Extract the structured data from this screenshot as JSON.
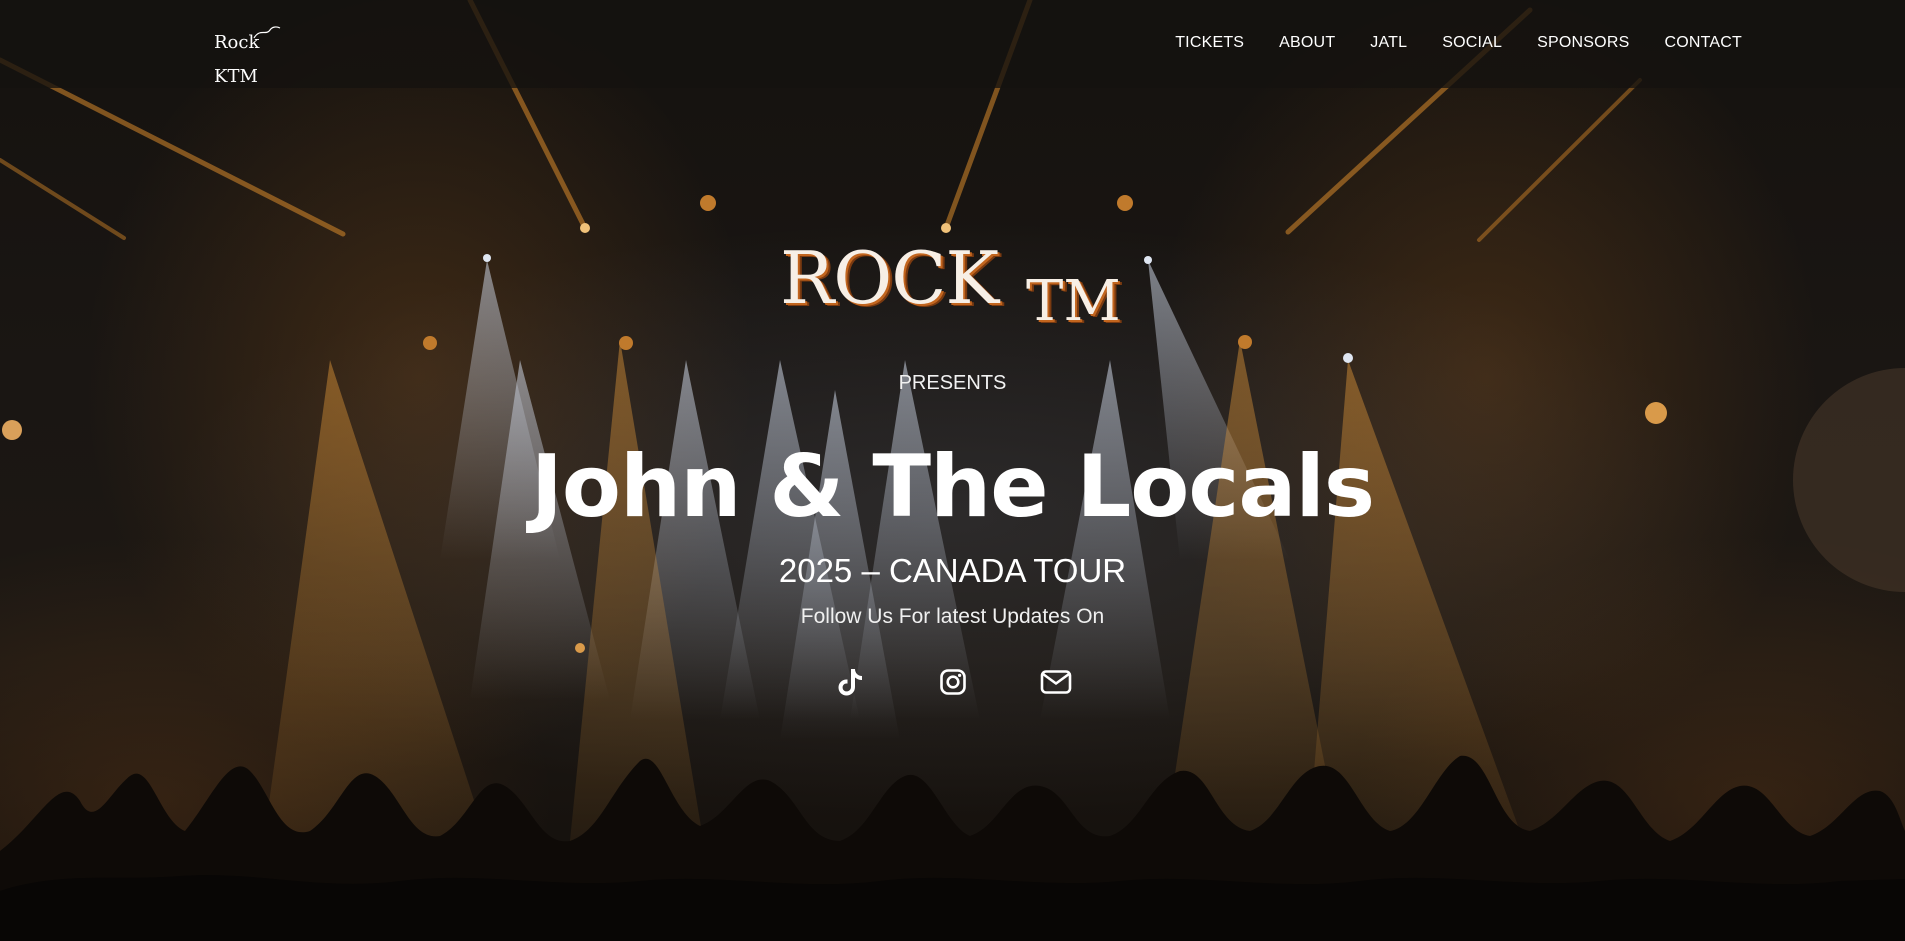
{
  "nav": {
    "logo_text": "Rock KTM",
    "links": [
      {
        "label": "TICKETS"
      },
      {
        "label": "ABOUT"
      },
      {
        "label": "JATL"
      },
      {
        "label": "SOCIAL"
      },
      {
        "label": "SPONSORS"
      },
      {
        "label": "CONTACT"
      }
    ]
  },
  "hero": {
    "brand_main": "ROCK",
    "brand_sub": "TM",
    "presents": "PRESENTS",
    "headline": "John & The Locals",
    "tour": "2025 – CANADA TOUR",
    "follow": "Follow Us For latest Updates On",
    "socials": [
      {
        "icon": "tiktok-icon"
      },
      {
        "icon": "instagram-icon"
      },
      {
        "icon": "mail-icon"
      }
    ]
  },
  "colors": {
    "text": "#ffffff",
    "brand_accent": "#c2651e",
    "nav_background": "#141210",
    "stage_light": "#d98a2b"
  }
}
